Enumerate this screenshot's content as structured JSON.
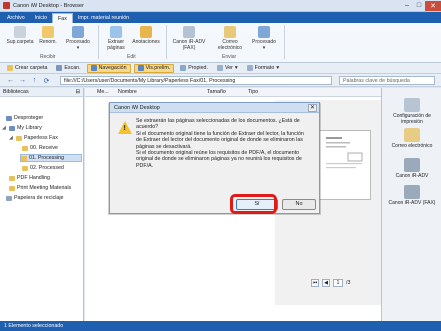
{
  "window": {
    "title": "Canon iW Desktop - Browser"
  },
  "ribbon_tabs": [
    "Archivo",
    "Inicio",
    "Fax",
    "Impr. material reunión"
  ],
  "active_tab": "Fax",
  "ribbon": {
    "buttons": [
      {
        "label": "Sup.carpeta"
      },
      {
        "label": "Renom."
      },
      {
        "label": "Procesado"
      },
      {
        "label": "Extraer páginas"
      },
      {
        "label": "Anotaciones"
      },
      {
        "label": "Canon iR-ADV (FAX)"
      },
      {
        "label": "Correo electrónico"
      },
      {
        "label": "Procesado"
      }
    ],
    "groups": [
      "Recibir",
      "Edit",
      "Enviar"
    ]
  },
  "toolbar": {
    "items": [
      "Crear carpeta",
      "Escan.",
      "Navegación",
      "Vis.prelim.",
      "Propied.",
      "Ver",
      "Formato"
    ]
  },
  "address": {
    "path": "file:///C:/Users/user/Documents/My Library/Paperless Fax/01. Processing",
    "search_placeholder": "Palabras clave de búsqueda"
  },
  "left_pane": {
    "header": "Bibliotecas",
    "items": [
      {
        "label": "Desproteger"
      },
      {
        "label": "My Library"
      },
      {
        "label": "Paperless Fax"
      },
      {
        "label": "00. Receive"
      },
      {
        "label": "01. Processing"
      },
      {
        "label": "02. Processed"
      },
      {
        "label": "PDF Handling"
      },
      {
        "label": "Print Meeting Materials"
      },
      {
        "label": "Papelera de reciclaje"
      }
    ]
  },
  "columns": [
    "Me...",
    "Nombre",
    "Tamaño",
    "Tipo"
  ],
  "right_pane": {
    "items": [
      {
        "label": "Configuración de impresión"
      },
      {
        "label": "Correo electrónico"
      },
      {
        "label": "Canon iR-ADV"
      },
      {
        "label": "Canon iR-ADV (FAX)"
      }
    ]
  },
  "pager": {
    "current": "1",
    "total": "/3"
  },
  "status": "1 Elemento seleccionado",
  "dialog": {
    "title": "Canon iW Desktop",
    "message": "Se extraerán las páginas seleccionadas de los documentos. ¿Está de acuerdo?\nSi el documento original tiene la función de Extraer del lector, la función de Extraer del lector del documento original de donde se eliminaron las páginas se desactivará.\nSi el documento original reúne los requisitos de PDF/A, el documento original de donde se eliminaron páginas ya no reunirá los requisitos de PDF/A.",
    "yes_label": "Sí",
    "no_label": "No"
  }
}
